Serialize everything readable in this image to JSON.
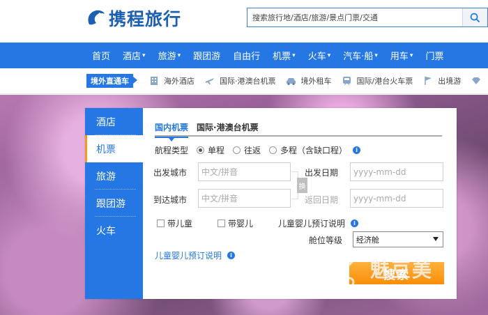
{
  "brand": {
    "logo_text": "携程旅行",
    "accent": "#2577e3"
  },
  "search": {
    "placeholder": "搜索旅行地/酒店/旅游/景点门票/交通"
  },
  "mainnav": {
    "items": [
      "首页",
      "酒店",
      "旅游",
      "跟团游",
      "自由行",
      "机票",
      "火车",
      "汽车·船",
      "用车",
      "门票"
    ]
  },
  "subnav": {
    "tag": "境外直通车",
    "items": [
      {
        "label": "海外酒店",
        "icon": "hotel-building-icon"
      },
      {
        "label": "国际·港澳台机票",
        "icon": "airplane-icon"
      },
      {
        "label": "境外租车",
        "icon": "car-icon"
      },
      {
        "label": "国际/港台火车票",
        "icon": "train-icon"
      },
      {
        "label": "出境游",
        "icon": "flag-icon"
      },
      {
        "label": "",
        "icon": "diamond-icon"
      }
    ]
  },
  "booking": {
    "side_tabs": [
      "酒店",
      "机票",
      "旅游",
      "跟团游",
      "火车"
    ],
    "active_side_tab": "机票",
    "tabs": [
      "国内机票",
      "国际·港澳台机票"
    ],
    "trip_type_label": "航程类型",
    "trip_types": [
      "单程",
      "往返",
      "多程（含缺口程）"
    ],
    "selected_trip_type": "单程",
    "depart_city_label": "出发城市",
    "depart_city_placeholder": "中文/拼音",
    "arrive_city_label": "到达城市",
    "arrive_city_placeholder": "中文/拼音",
    "swap_label": "换",
    "depart_date_label": "出发日期",
    "depart_date_placeholder": "yyyy-mm-dd",
    "return_date_label": "返回日期",
    "return_date_placeholder": "yyyy-mm-dd",
    "with_child": "带儿童",
    "with_infant": "带婴儿",
    "child_infant_note": "儿童婴儿预订说明",
    "cabin_label": "舱位等级",
    "cabin_value": "经济舱",
    "child_infant_link": "儿童婴儿预订说明",
    "search_button": "搜索"
  },
  "watermark": {
    "text": "魅豆美"
  }
}
